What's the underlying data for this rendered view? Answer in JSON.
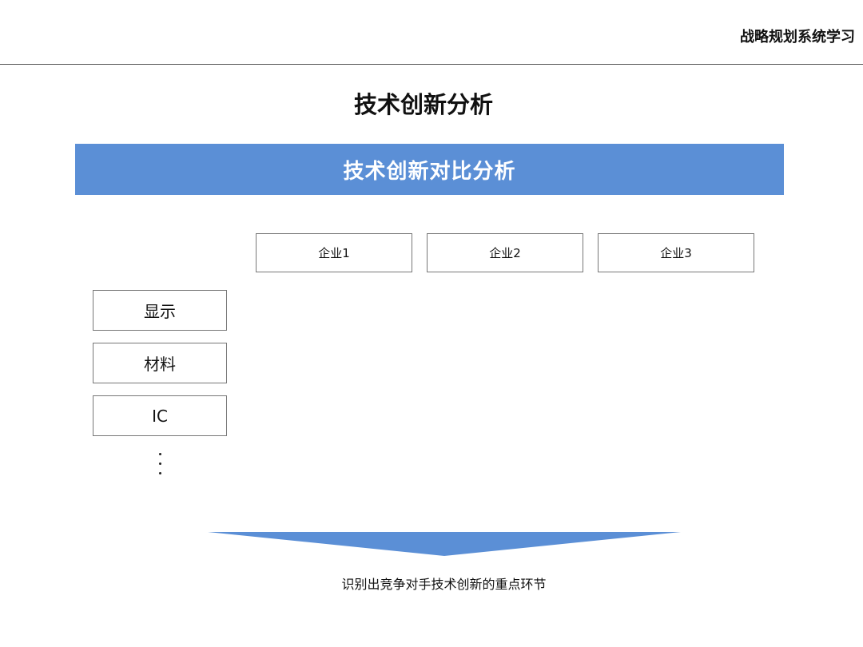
{
  "header": {
    "title": "战略规划系统学习"
  },
  "page": {
    "title": "技术创新分析"
  },
  "banner": {
    "text": "技术创新对比分析",
    "color": "#5b8fd6"
  },
  "columns": [
    "企业1",
    "企业2",
    "企业3"
  ],
  "rows": [
    "显示",
    "材料",
    "IC"
  ],
  "ellipsis": "⋮",
  "footer": {
    "text": "识别出竞争对手技术创新的重点环节",
    "arrow_color": "#5b8fd6"
  }
}
